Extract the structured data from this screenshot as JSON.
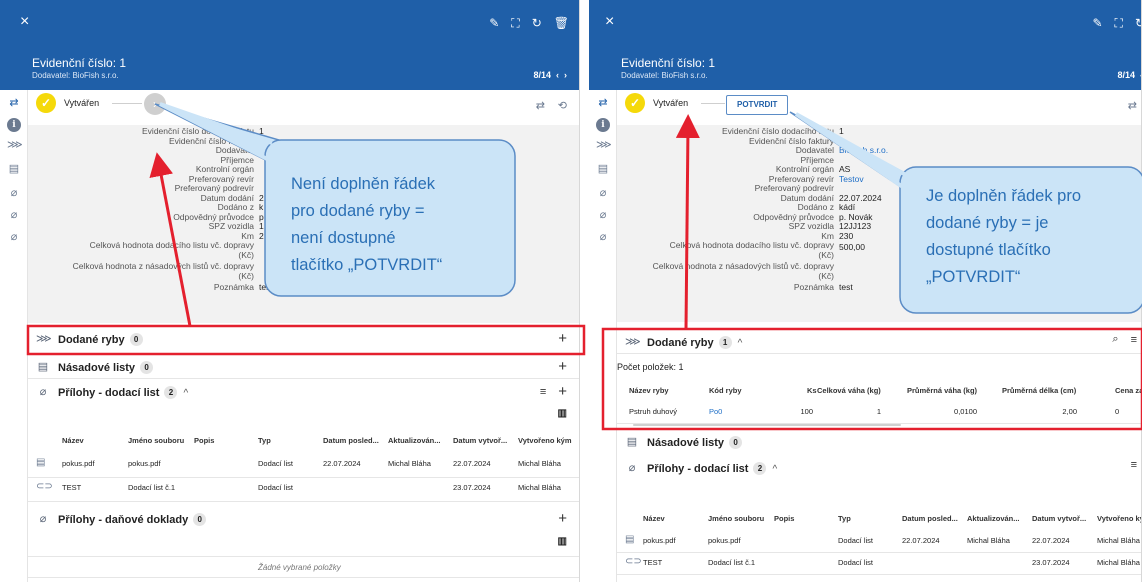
{
  "common": {
    "close_glyph": "×",
    "title": "Evidenční číslo: 1",
    "supplier": "Dodavatel: BioFish s.r.o.",
    "pager": "8/14",
    "step1_label": "Vytvářen",
    "colors": {
      "brand": "#1f5fa8",
      "accent_yellow": "#f5d90a",
      "highlight_red": "#e4202e",
      "link": "#1f6fc7",
      "callout_fill": "#cbe4f7",
      "callout_stroke": "#5b8cc6"
    }
  },
  "left": {
    "details": [
      {
        "label": "Evidenční číslo dodacího listu",
        "value": "1"
      },
      {
        "label": "Evidenční číslo faktury",
        "value": "1"
      },
      {
        "label": "Dodavatel",
        "value": "Bi"
      },
      {
        "label": "Příjemce",
        "value": ""
      },
      {
        "label": "Kontrolní orgán",
        "value": ""
      },
      {
        "label": "Preferovaný revír",
        "value": ""
      },
      {
        "label": "Preferovaný podrevír",
        "value": ""
      },
      {
        "label": "Datum dodání",
        "value": "2"
      },
      {
        "label": "Dodáno z",
        "value": "k"
      },
      {
        "label": "Odpovědný průvodce",
        "value": "p"
      },
      {
        "label": "SPZ vozidla",
        "value": "1"
      },
      {
        "label": "Km",
        "value": "2"
      },
      {
        "label": "Celková hodnota dodacího listu vč. dopravy (Kč)",
        "value": ""
      },
      {
        "label": "Celková hodnota z násadových listů vč. dopravy (Kč)",
        "value": ""
      },
      {
        "label": "Poznámka",
        "value": "test"
      }
    ],
    "sections": {
      "dodane_ryby": {
        "title": "Dodané ryby",
        "count": "0"
      },
      "nasadove_listy": {
        "title": "Násadové listy",
        "count": "0"
      },
      "prilohy_dodaci": {
        "title": "Přílohy - dodací list",
        "count": "2"
      },
      "prilohy_danove": {
        "title": "Přílohy - daňové doklady",
        "count": "0"
      }
    },
    "attachments_columns": [
      "Název",
      "Jméno souboru",
      "Popis",
      "Typ",
      "Datum posled...",
      "Aktualizován...",
      "Datum vytvoř...",
      "Vytvořeno kým"
    ],
    "attachments_rows": [
      [
        "pokus.pdf",
        "pokus.pdf",
        "",
        "Dodací list",
        "22.07.2024",
        "Michal Bláha",
        "22.07.2024",
        "Michal Bláha"
      ],
      [
        "TEST",
        "Dodací list č.1",
        "",
        "Dodací list",
        "",
        "",
        "23.07.2024",
        "Michal Bláha"
      ]
    ],
    "empty_text": "Žádné vybrané položky",
    "callout": [
      "Není doplněn řádek",
      "pro dodané ryby =",
      "není dostupné",
      "tlačítko „POTVRDIT“"
    ]
  },
  "right": {
    "potvrdit_label": "POTVRDIT",
    "details": [
      {
        "label": "Evidenční číslo dodacího listu",
        "value": "1"
      },
      {
        "label": "Evidenční číslo faktury",
        "value": "1"
      },
      {
        "label": "Dodavatel",
        "value": "BioFish s.r.o."
      },
      {
        "label": "Příjemce",
        "value": ""
      },
      {
        "label": "Kontrolní orgán",
        "value": "AS"
      },
      {
        "label": "Preferovaný revír",
        "value": "Testov"
      },
      {
        "label": "Preferovaný podrevír",
        "value": ""
      },
      {
        "label": "Datum dodání",
        "value": "22.07.2024"
      },
      {
        "label": "Dodáno z",
        "value": "kádí"
      },
      {
        "label": "Odpovědný průvodce",
        "value": "p. Novák"
      },
      {
        "label": "SPZ vozidla",
        "value": "12JJ123"
      },
      {
        "label": "Km",
        "value": "230"
      },
      {
        "label": "Celková hodnota dodacího listu vč. dopravy (Kč)",
        "value": "500,00"
      },
      {
        "label": "Celková hodnota z násadových listů vč. dopravy (Kč)",
        "value": ""
      },
      {
        "label": "Poznámka",
        "value": "test"
      }
    ],
    "sections": {
      "dodane_ryby": {
        "title": "Dodané ryby",
        "count": "1"
      },
      "nasadove_listy": {
        "title": "Násadové listy",
        "count": "0"
      },
      "prilohy_dodaci": {
        "title": "Přílohy - dodací list",
        "count": "2"
      }
    },
    "pocet_polozek": "Počet položek: 1",
    "fish_columns": [
      "Název ryby",
      "Kód ryby",
      "Ks",
      "Celková váha (kg)",
      "Průměrná váha (kg)",
      "Průměrná délka (cm)",
      "Cena za jednot"
    ],
    "fish_rows": [
      [
        "Pstruh duhový",
        "Po0",
        "100",
        "1",
        "0,0100",
        "2,00",
        "0"
      ]
    ],
    "attachments_columns": [
      "Název",
      "Jméno souboru",
      "Popis",
      "Typ",
      "Datum posled...",
      "Aktualizován...",
      "Datum vytvoř...",
      "Vytvořeno ky"
    ],
    "attachments_rows": [
      [
        "pokus.pdf",
        "pokus.pdf",
        "",
        "Dodací list",
        "22.07.2024",
        "Michal Bláha",
        "22.07.2024",
        "Michal Bláha"
      ],
      [
        "TEST",
        "Dodací list č.1",
        "",
        "Dodací list",
        "",
        "",
        "23.07.2024",
        "Michal Bláha"
      ]
    ],
    "callout": [
      "Je doplněn řádek pro",
      "dodané ryby = je",
      "dostupné tlačítko",
      "„POTVRDIT“"
    ]
  }
}
